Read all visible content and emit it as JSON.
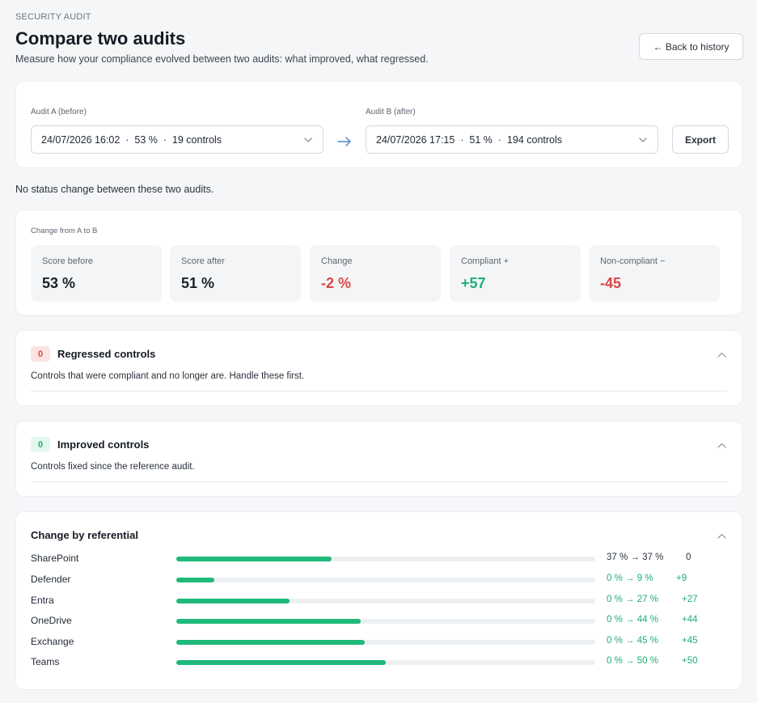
{
  "header": {
    "eyebrow": "SECURITY AUDIT",
    "title": "Compare two audits",
    "subtitle": "Measure how your compliance evolved between two audits: what improved, what regressed.",
    "back_label": "← Back to history"
  },
  "selectors": {
    "audit_a_label": "Audit A (before)",
    "audit_a_value": "24/07/2026 16:02  ·  53 %  ·  19 controls",
    "audit_b_label": "Audit B (after)",
    "audit_b_value": "24/07/2026 17:15  ·  51 %  ·  194 controls",
    "export_label": "Export"
  },
  "notice": "No status change between these two audits.",
  "summary": {
    "label": "Change from A to B",
    "stats": [
      {
        "label": "Score before",
        "value": "53 %"
      },
      {
        "label": "Score after",
        "value": "51 %"
      },
      {
        "label": "Change",
        "value": "-2 %"
      },
      {
        "label": "Compliant +",
        "value": "+57"
      },
      {
        "label": "Non-compliant −",
        "value": "-45"
      }
    ]
  },
  "regressed": {
    "count": "0",
    "title": "Regressed controls",
    "description": "Controls that were compliant and no longer are. Handle these first."
  },
  "improved": {
    "count": "0",
    "title": "Improved controls",
    "description": "Controls fixed since the reference audit."
  },
  "referential": {
    "title": "Change by referential",
    "rows": [
      {
        "name": "SharePoint",
        "before": 37,
        "after": 37,
        "range": "37 % → 37 %",
        "delta": "0"
      },
      {
        "name": "Defender",
        "before": 0,
        "after": 9,
        "range": "0 % → 9 %",
        "delta": "+9"
      },
      {
        "name": "Entra",
        "before": 0,
        "after": 27,
        "range": "0 % → 27 %",
        "delta": "+27"
      },
      {
        "name": "OneDrive",
        "before": 0,
        "after": 44,
        "range": "0 % → 44 %",
        "delta": "+44"
      },
      {
        "name": "Exchange",
        "before": 0,
        "after": 45,
        "range": "0 % → 45 %",
        "delta": "+45"
      },
      {
        "name": "Teams",
        "before": 0,
        "after": 50,
        "range": "0 % → 50 %",
        "delta": "+50"
      }
    ]
  },
  "colors": {
    "positive": "#1fad74",
    "negative": "#d94848",
    "bar_fill": "#1fb97a",
    "bar_track": "#edf0f3"
  }
}
